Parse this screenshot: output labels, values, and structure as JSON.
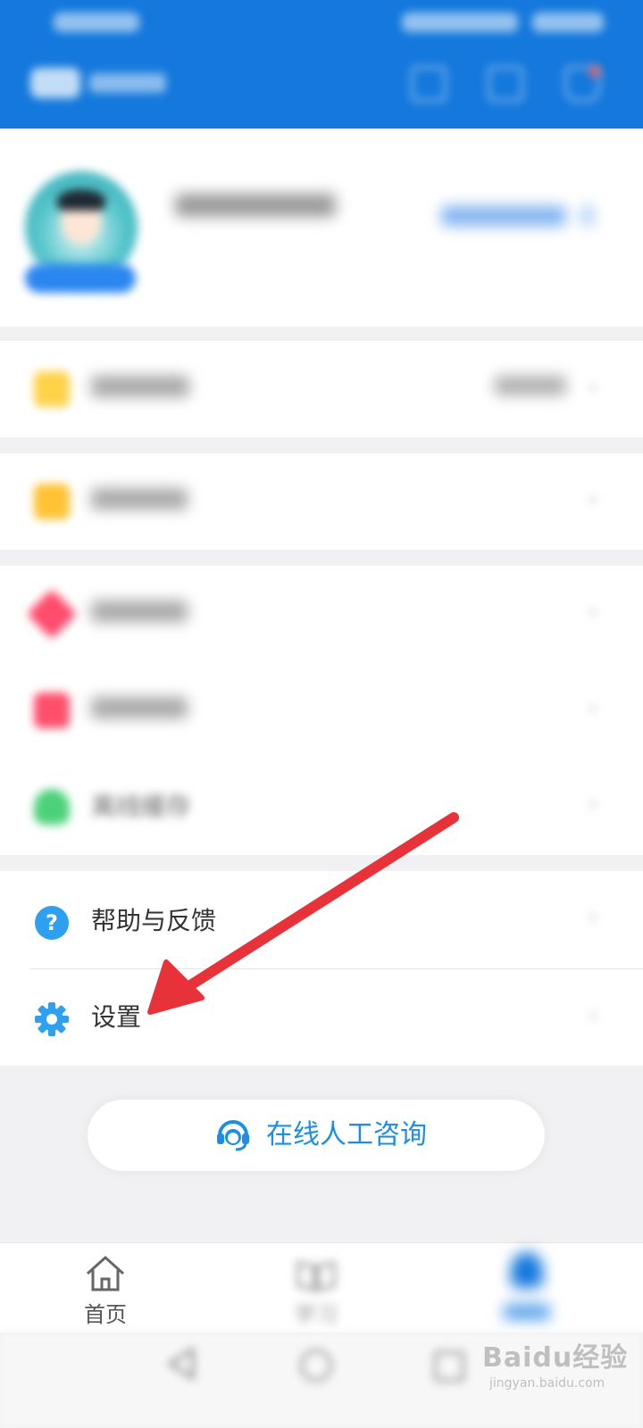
{
  "header": {
    "icons": [
      "scan-icon",
      "message-icon",
      "cart-icon"
    ]
  },
  "menu": {
    "help": {
      "label": "帮助与反馈",
      "icon": "question-circle-icon"
    },
    "settings": {
      "label": "设置",
      "icon": "gear-icon"
    },
    "offline_cache": {
      "label": "离线缓存",
      "icon": "cloud-download-icon"
    }
  },
  "consult": {
    "label": "在线人工咨询",
    "icon": "headset-icon"
  },
  "bottom_nav": {
    "home": "首页",
    "study": "学习"
  },
  "watermark": {
    "main": "Baidu经验",
    "sub": "jingyan.baidu.com"
  },
  "colors": {
    "header_blue": "#1478dc",
    "accent_blue": "#1c8fe4",
    "arrow_red": "#e8323a"
  }
}
